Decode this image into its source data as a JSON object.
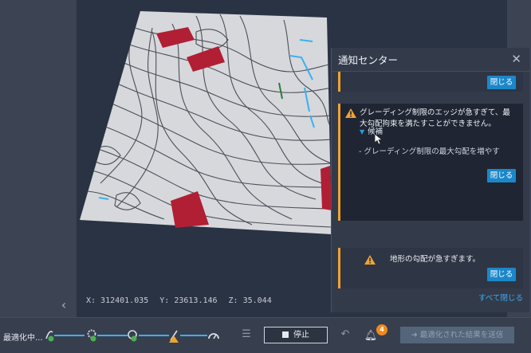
{
  "viewport": {
    "coords": {
      "x": "X: 312401.035",
      "y": "Y: 23613.146",
      "z": "Z: 35.044"
    }
  },
  "notification_center": {
    "title": "通知センター",
    "close_label": "閉じる",
    "card_a": {
      "message_line1": "グレーディング制限のエッジが急すぎて、最",
      "message_line2": "大勾配拘束を満たすことができません。",
      "candidates_label": "候補",
      "suggestion": "- グレーディング制限の最大勾配を増やす"
    },
    "card_b": {
      "message": "地形の勾配が急すぎます。"
    },
    "close_all_label": "すべて閉じる"
  },
  "statusbar": {
    "optimizing_label": "最適化中...",
    "stop_label": "停止",
    "notification_count": "4",
    "send_label": "最適化された結果を送信"
  },
  "colors": {
    "accent": "#1b87c9",
    "warning": "#f0a330",
    "building": "#b01f33"
  }
}
